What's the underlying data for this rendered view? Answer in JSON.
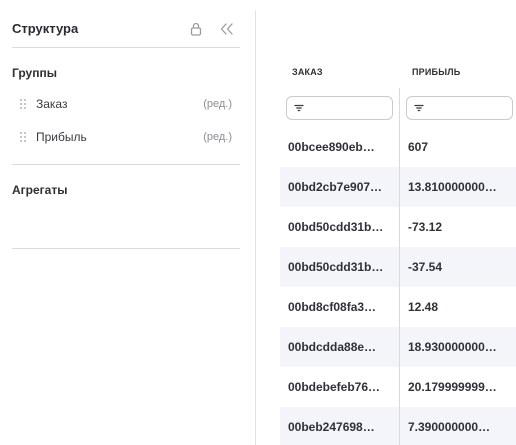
{
  "panel": {
    "title": "Структура",
    "groups_label": "Группы",
    "aggregates_label": "Агрегаты",
    "groups": [
      {
        "label": "Заказ",
        "edit": "(ред.)"
      },
      {
        "label": "Прибыль",
        "edit": "(ред.)"
      }
    ]
  },
  "table": {
    "columns": [
      "ЗАКАЗ",
      "ПРИБЫЛЬ"
    ],
    "rows": [
      [
        "00bcee890eb…",
        "607"
      ],
      [
        "00bd2cb7e907…",
        "13.810000000…"
      ],
      [
        "00bd50cdd31b…",
        "-73.12"
      ],
      [
        "00bd50cdd31b…",
        "-37.54"
      ],
      [
        "00bd8cf08fa3…",
        "12.48"
      ],
      [
        "00bdcdda88e…",
        "18.930000000…"
      ],
      [
        "00bdebefeb76…",
        "20.179999999…"
      ],
      [
        "00beb247698…",
        "7.390000000…"
      ]
    ]
  },
  "icons": {
    "lock": "lock-icon",
    "collapse": "double-chevron-left-icon",
    "drag": "drag-handle-icon",
    "filter": "filter-icon"
  },
  "colors": {
    "stripe": "#f3f5fa",
    "icon": "#9a9aa3",
    "divider": "#dcdcdf"
  }
}
